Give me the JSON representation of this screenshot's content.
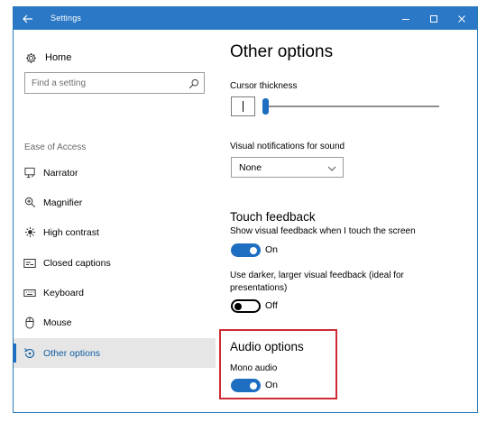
{
  "window": {
    "title": "Settings"
  },
  "sidebar": {
    "home_label": "Home",
    "search_placeholder": "Find a setting",
    "section_label": "Ease of Access",
    "items": [
      {
        "label": "Narrator",
        "icon": "narrator-icon"
      },
      {
        "label": "Magnifier",
        "icon": "magnifier-icon"
      },
      {
        "label": "High contrast",
        "icon": "high-contrast-icon"
      },
      {
        "label": "Closed captions",
        "icon": "closed-captions-icon"
      },
      {
        "label": "Keyboard",
        "icon": "keyboard-icon"
      },
      {
        "label": "Mouse",
        "icon": "mouse-icon"
      },
      {
        "label": "Other options",
        "icon": "other-options-icon",
        "selected": true
      }
    ]
  },
  "main": {
    "title": "Other options",
    "cursor_thickness": {
      "label": "Cursor thickness",
      "level": 0.0
    },
    "visual_notifications": {
      "label": "Visual notifications for sound",
      "selected": "None"
    },
    "touch_feedback": {
      "heading": "Touch feedback",
      "show_label": "Show visual feedback when I touch the screen",
      "show_state": "On",
      "show_on": true,
      "darker_label": "Use darker, larger visual feedback (ideal for presentations)",
      "darker_state": "Off",
      "darker_on": false
    },
    "audio_options": {
      "heading": "Audio options",
      "mono_label": "Mono audio",
      "mono_state": "On",
      "mono_on": true
    }
  },
  "colors": {
    "titlebar": "#2b78c6",
    "accent": "#1d6ec0",
    "highlight_box": "#cf2a35",
    "selected_bg": "#e6e6e6"
  }
}
